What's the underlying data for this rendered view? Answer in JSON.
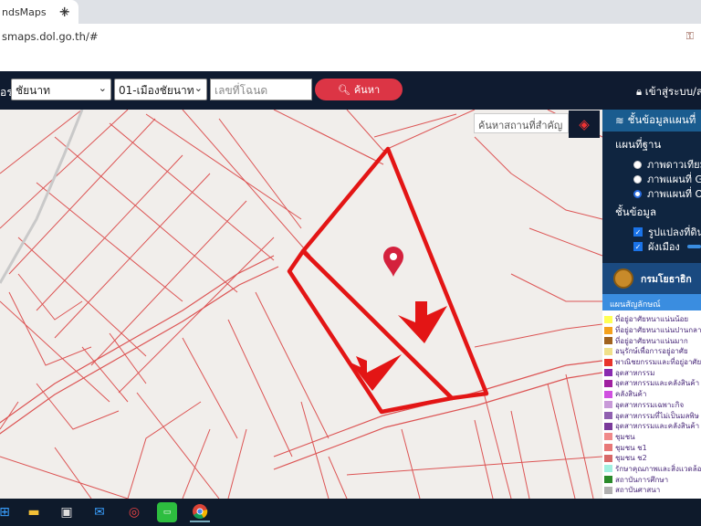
{
  "browser": {
    "tab_title": "ndsMaps",
    "tab_close": "×",
    "new_tab": "+",
    "url": "smaps.dol.go.th/#",
    "extension_icon": "lock-icon"
  },
  "navbar": {
    "label": "อร",
    "province": "ชัยนาท",
    "district": "01-เมืองชัยนาท",
    "deed_placeholder": "เลขที่โฉนด",
    "search_label": "ค้นหา",
    "login_label": "เข้าสู่ระบบ/ล"
  },
  "map": {
    "place_search_placeholder": "ค้นหาสถานที่สำคัญ",
    "boundary_color": "#e31515",
    "parcel_line_color": "#d93a3a",
    "marker_color": "#d4213d"
  },
  "panel": {
    "header": "ชั้นข้อมูลแผนที่",
    "basemap_title": "แผนที่ฐาน",
    "basemaps": [
      {
        "label": "ภาพดาวเทียม",
        "selected": false
      },
      {
        "label": "ภาพแผนที่ G",
        "selected": false
      },
      {
        "label": "ภาพแผนที่ O",
        "selected": true
      }
    ],
    "layers_title": "ชั้นข้อมูล",
    "layers": [
      {
        "label": "รูปแปลงที่ดิน",
        "checked": true
      },
      {
        "label": "ผังเมือง",
        "checked": true
      }
    ],
    "department": "กรมโยธาธิก",
    "legend_title": "แผนสัญลักษณ์",
    "legend": [
      {
        "label": "ที่อยู่อาศัยหนาแน่นน้อย",
        "color": "#ffff55"
      },
      {
        "label": "ที่อยู่อาศัยหนาแน่นปานกลาง",
        "color": "#f4a11c"
      },
      {
        "label": "ที่อยู่อาศัยหนาแน่นมาก",
        "color": "#a0621e"
      },
      {
        "label": "อนุรักษ์เพื่อการอยู่อาศัย",
        "color": "#f0e08a"
      },
      {
        "label": "พาณิชยกรรมและที่อยู่อาศัย",
        "color": "#e8332b"
      },
      {
        "label": "อุตสาหกรรม",
        "color": "#8a2bb0"
      },
      {
        "label": "อุตสาหกรรมและคลังสินค้า",
        "color": "#a020a0"
      },
      {
        "label": "คลังสินค้า",
        "color": "#d050e0"
      },
      {
        "label": "อุตสาหกรรมเฉพาะกิจ",
        "color": "#c89ad8"
      },
      {
        "label": "อุตสาหกรรมที่ไม่เป็นมลพิษ",
        "color": "#9060b0"
      },
      {
        "label": "อุตสาหกรรมและคลังสินค้า",
        "color": "#7a3a9a"
      },
      {
        "label": "ชุมชน",
        "color": "#f08a8a"
      },
      {
        "label": "ชุมชน ช1",
        "color": "#e87878"
      },
      {
        "label": "ชุมชน ช2",
        "color": "#d86868"
      },
      {
        "label": "รักษาคุณภาพและสิ่งแวดล้อม",
        "color": "#a0f0e0"
      },
      {
        "label": "สถาบันการศึกษา",
        "color": "#2a8a2a"
      },
      {
        "label": "สถาบันศาสนา",
        "color": "#b0b0b0"
      }
    ]
  },
  "taskbar": {
    "icons": [
      "windows-start-icon",
      "file-explorer-icon",
      "store-icon",
      "mail-icon",
      "media-icon",
      "line-app-icon",
      "chrome-icon"
    ]
  }
}
